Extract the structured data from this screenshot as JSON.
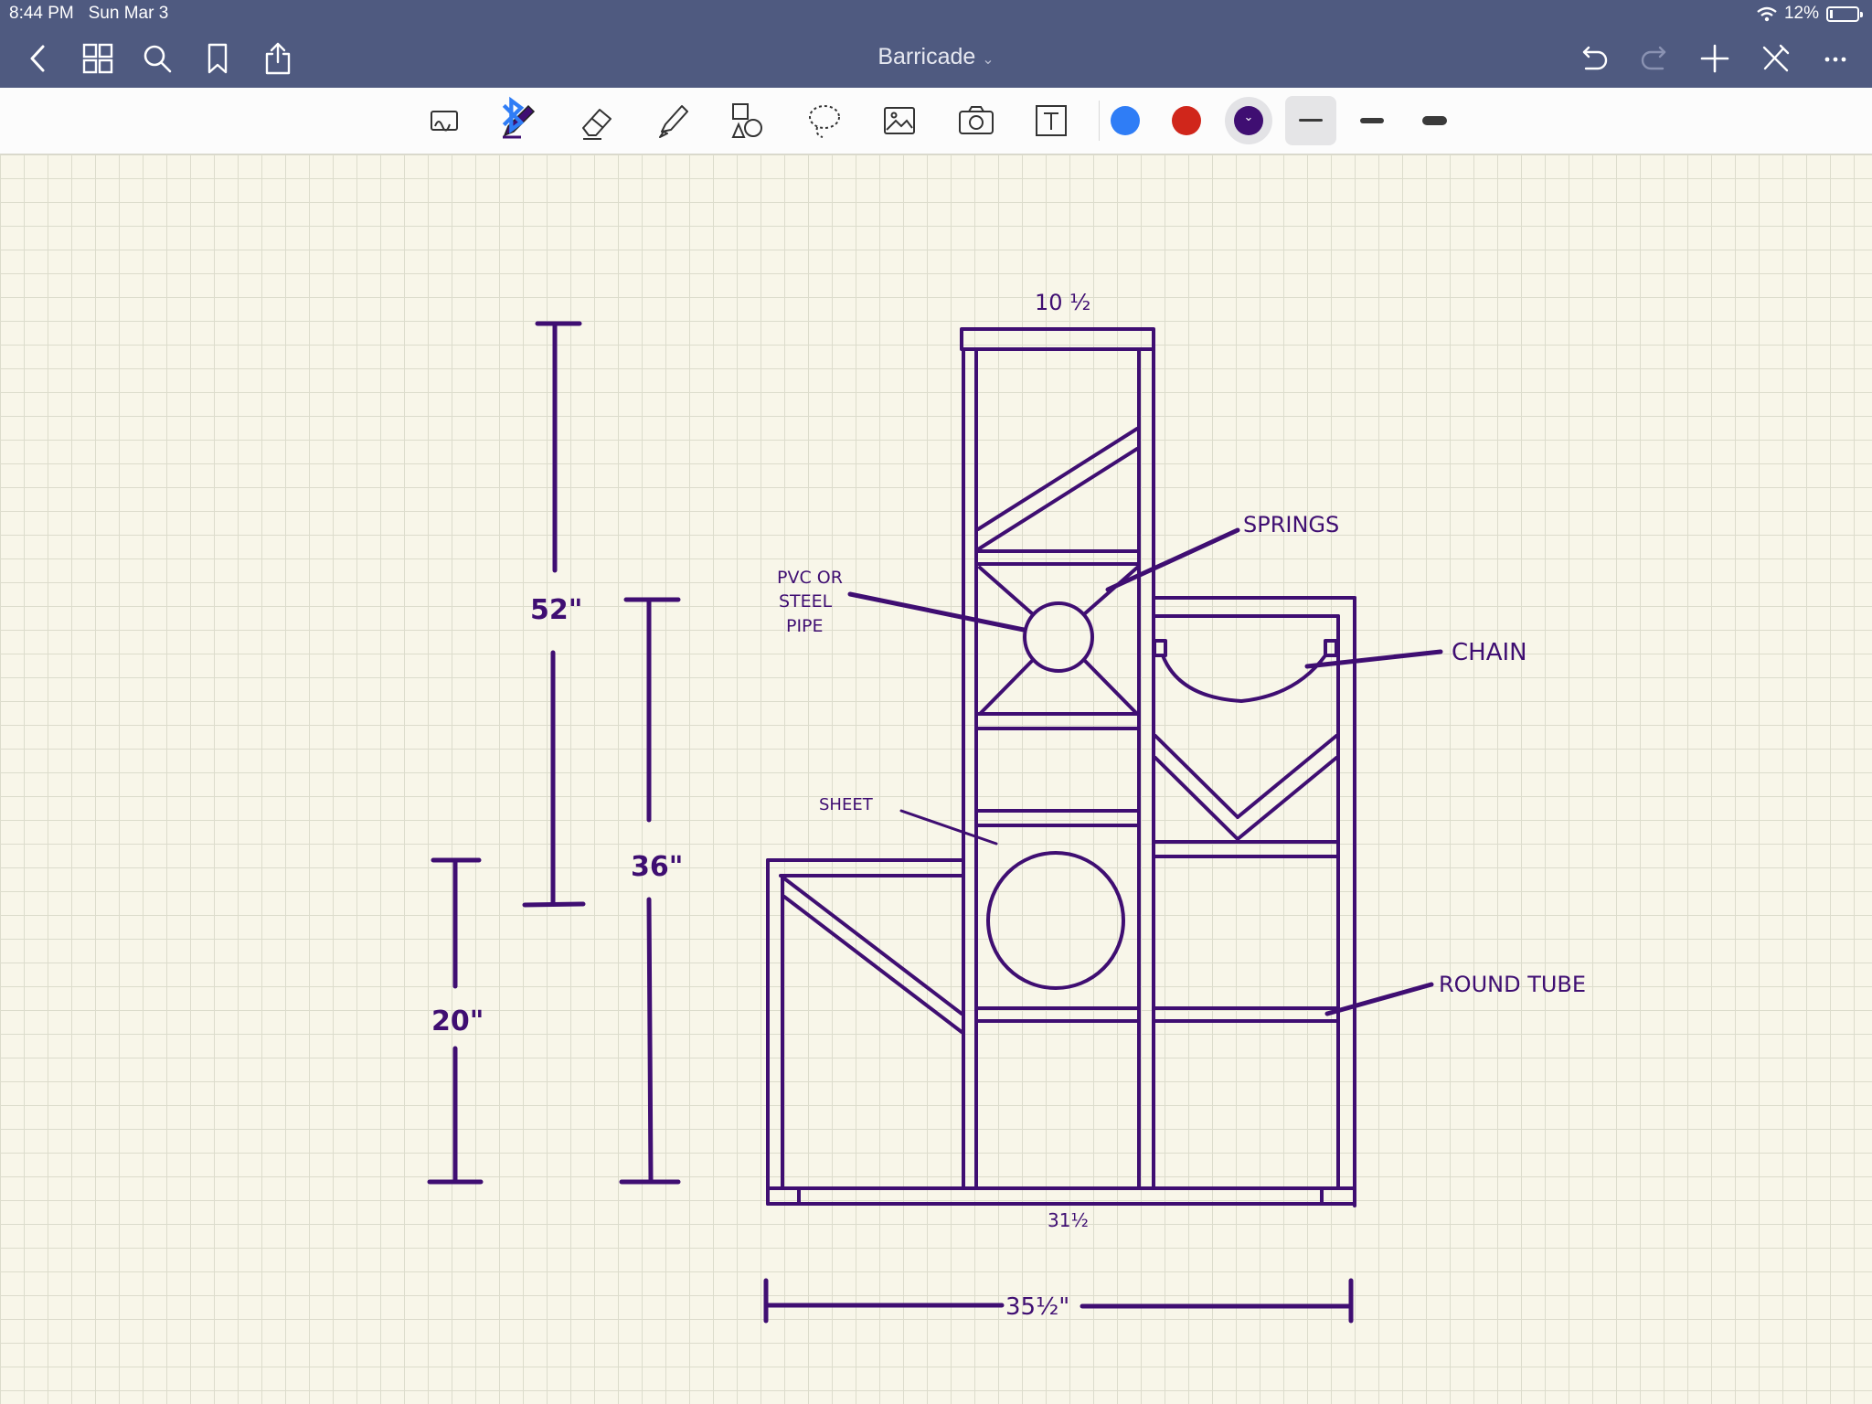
{
  "status": {
    "time": "8:44 PM",
    "date": "Sun Mar 3",
    "battery": "12%",
    "battery_level": 0.12
  },
  "document": {
    "title": "Barricade"
  },
  "nav_left": [
    "back-icon",
    "grid-icon",
    "search-icon",
    "bookmark-icon",
    "share-icon"
  ],
  "nav_right": [
    "undo-icon",
    "redo-icon",
    "add-page-icon",
    "pen-off-icon",
    "more-icon"
  ],
  "tools": [
    "keyboard-handwriting-icon",
    "pen-icon",
    "eraser-icon",
    "highlighter-icon",
    "shapes-icon",
    "lasso-icon",
    "image-icon",
    "camera-icon",
    "text-box-icon"
  ],
  "colors": {
    "ink": "#3f0e72",
    "swatch_blue": "#2f7df6",
    "swatch_red": "#d0261b",
    "swatch_purple": "#3f0e72",
    "navbar": "#4f5a80",
    "paper": "#f8f6e9"
  },
  "sketch_labels": {
    "top_width": "10 ½",
    "height_total": "52\"",
    "height_mid": "36\"",
    "height_low": "20\"",
    "pvc_1": "PVC OR",
    "pvc_2": "STEEL",
    "pvc_3": "PIPE",
    "springs": "SPRINGS",
    "chain": "CHAIN",
    "sheet": "SHEET",
    "round_tube": "ROUND TUBE",
    "inner_width": "31½",
    "total_width": "35½\""
  }
}
